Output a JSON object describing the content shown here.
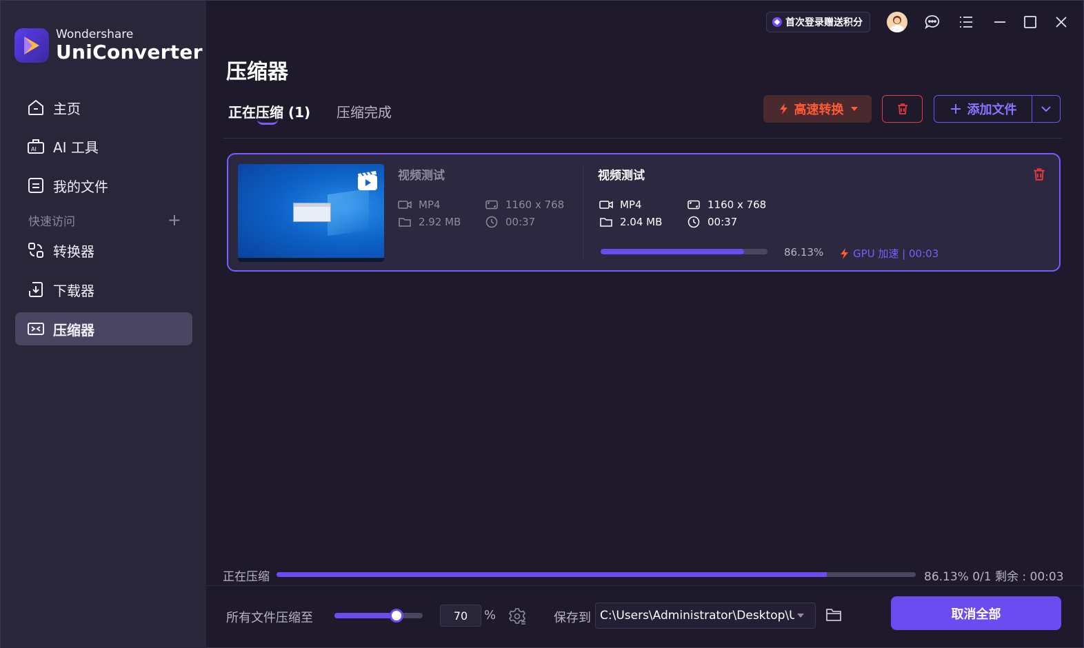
{
  "brand": {
    "small": "Wondershare",
    "big": "UniConverter"
  },
  "sidebar": {
    "items": [
      {
        "label": "主页",
        "icon": "home-icon"
      },
      {
        "label": "AI 工具",
        "icon": "ai-toolbox-icon"
      },
      {
        "label": "我的文件",
        "icon": "document-icon"
      },
      {
        "label": "转换器",
        "icon": "converter-icon"
      },
      {
        "label": "下载器",
        "icon": "downloader-icon"
      },
      {
        "label": "压缩器",
        "icon": "compressor-icon",
        "active": true
      }
    ],
    "quick_access": "快速访问",
    "quick_add": "+"
  },
  "topbar": {
    "promo": "首次登录赠送积分",
    "icons": [
      "avatar-icon",
      "chat-icon",
      "menu-list-icon",
      "minimize-icon",
      "maximize-icon",
      "close-icon"
    ]
  },
  "page": {
    "title": "压缩器"
  },
  "tabs": {
    "active": "正在压缩 (1)",
    "done": "压缩完成"
  },
  "toolbar": {
    "fast_convert": "高速转换",
    "add_file": "添加文件"
  },
  "file": {
    "source": {
      "name": "视频测试",
      "format": "MP4",
      "size": "2.92 MB",
      "resolution": "1160 x 768",
      "duration": "00:37"
    },
    "target": {
      "name": "视频测试",
      "format": "MP4",
      "size": "2.04 MB",
      "resolution": "1160 x 768",
      "duration": "00:37"
    },
    "progress": 0.8613,
    "progress_label": "86.13%",
    "gpu_label": "GPU 加速 | 00:03"
  },
  "overall": {
    "label": "正在压缩",
    "progress": 0.8613,
    "status": "86.13% 0/1 剩余 : 00:03"
  },
  "bottom": {
    "compress_label": "所有文件压缩至",
    "compress_value": 70,
    "compress_value_text": "70",
    "percent_sign": "%",
    "save_label": "保存到",
    "save_path": "C:\\Users\\Administrator\\Desktop\\U",
    "cancel_all": "取消全部"
  },
  "colors": {
    "accent": "#6b4cf0",
    "danger": "#e23b3b",
    "fast": "#ff5a34",
    "bg": "#1e1a2c",
    "sidebar": "#2a2639"
  }
}
